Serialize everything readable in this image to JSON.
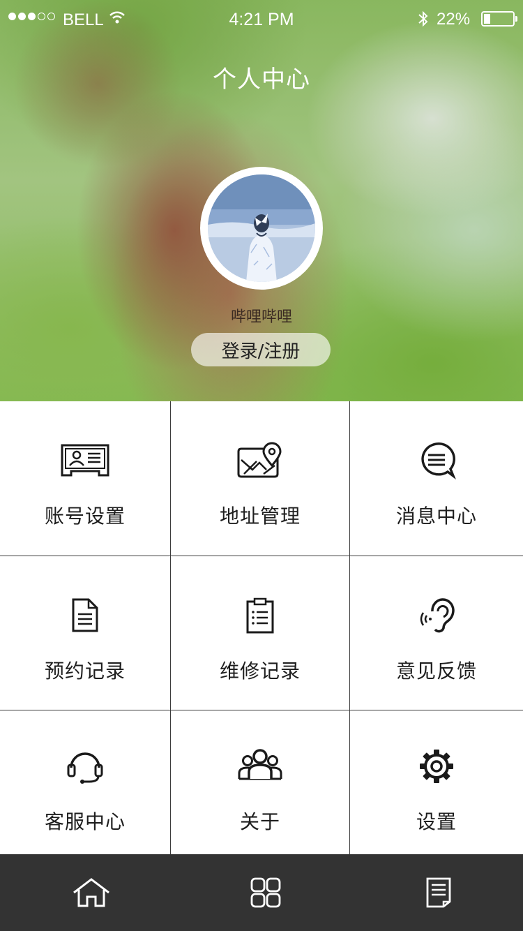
{
  "status_bar": {
    "carrier": "BELL",
    "time": "4:21 PM",
    "battery_percent_label": "22%",
    "battery_level": 0.22,
    "signal_bars_filled": 3,
    "signal_bars_total": 5,
    "icons": [
      "wifi-icon",
      "bluetooth-icon",
      "battery-icon"
    ]
  },
  "header": {
    "title": "个人中心"
  },
  "profile": {
    "username": "哔哩哔哩",
    "login_label": "登录/注册"
  },
  "menu": {
    "items": [
      {
        "label": "账号设置",
        "icon": "id-card-icon"
      },
      {
        "label": "地址管理",
        "icon": "map-pin-icon"
      },
      {
        "label": "消息中心",
        "icon": "message-bubble-icon"
      },
      {
        "label": "预约记录",
        "icon": "document-icon"
      },
      {
        "label": "维修记录",
        "icon": "clipboard-icon"
      },
      {
        "label": "意见反馈",
        "icon": "ear-icon"
      },
      {
        "label": "客服中心",
        "icon": "headset-icon"
      },
      {
        "label": "关于",
        "icon": "group-icon"
      },
      {
        "label": "设置",
        "icon": "gear-icon"
      }
    ]
  },
  "tabbar": {
    "tabs": [
      {
        "icon": "home-icon"
      },
      {
        "icon": "grid-icon"
      },
      {
        "icon": "list-document-icon"
      }
    ]
  },
  "colors": {
    "tabbar_bg": "#333333",
    "grid_line": "#3b3b3b",
    "icon_stroke": "#1a1a1a",
    "title_text": "#ffffff"
  }
}
